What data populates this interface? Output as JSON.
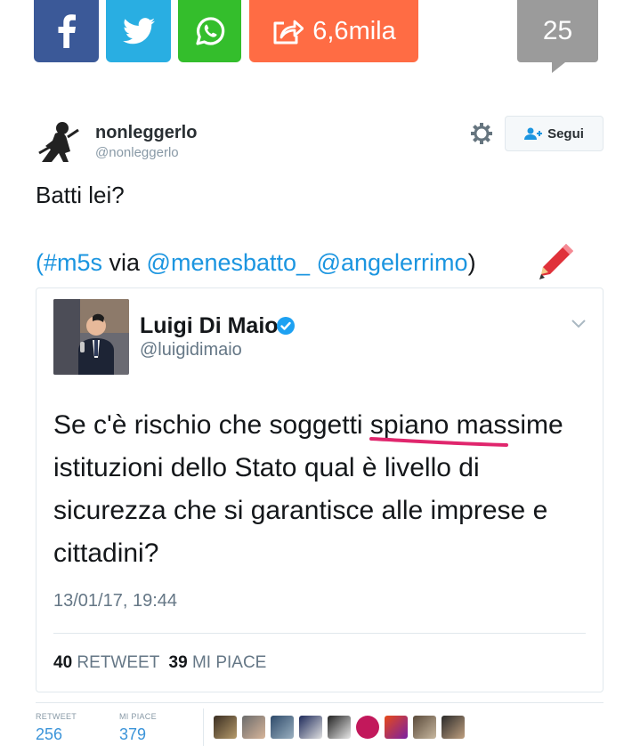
{
  "share_bar": {
    "share_count": "6,6mila",
    "comments_count": "25",
    "colors": {
      "facebook": "#3b5998",
      "twitter": "#29aee2",
      "whatsapp": "#34be2c",
      "share": "#ff6c44"
    }
  },
  "tweet": {
    "display_name": "nonleggerlo",
    "handle": "@nonleggerlo",
    "follow_label": "Segui",
    "text": "Batti lei?",
    "hashtag": "(#m5s",
    "via": " via ",
    "mention1": "@menesbatto_",
    "mention2": "@angelerrimo",
    "closing": ")"
  },
  "quoted": {
    "display_name": "Luigi Di Maio",
    "handle": "@luigidimaio",
    "text": "Se c'è rischio che soggetti spiano massime istituzioni dello Stato qual è livello di sicurezza che si garantisce alle imprese e cittadini?",
    "timestamp": "13/01/17, 19:44",
    "retweets": "40",
    "retweets_label": "RETWEET",
    "likes": "39",
    "likes_label": "MI PIACE"
  },
  "footer": {
    "retweet_label": "RETWEET",
    "retweet_count": "256",
    "like_label": "MI PIACE",
    "like_count": "379"
  },
  "icons": [
    "facebook-icon",
    "twitter-icon",
    "whatsapp-icon",
    "share-icon",
    "gear-icon",
    "follow-icon",
    "verified-icon",
    "chevron-down-icon",
    "pencil-icon"
  ]
}
